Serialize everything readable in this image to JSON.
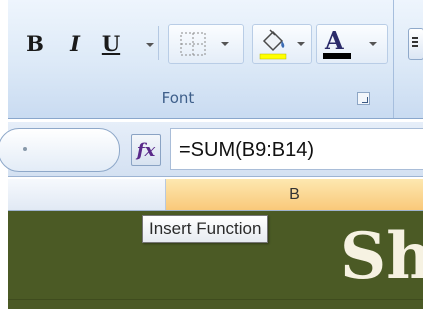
{
  "ribbon": {
    "font_group": {
      "label": "Font",
      "bold_label": "B",
      "italic_label": "I",
      "underline_label": "U",
      "font_color_label": "A",
      "font_color": "#000000",
      "fill_color": "#ffff00"
    }
  },
  "formula_bar": {
    "insert_function_label": "fx",
    "formula": "=SUM(B9:B14)"
  },
  "grid": {
    "column_b_label": "B",
    "sheet_background": "#4b5a25",
    "cell_text": "Sh"
  },
  "tooltip": {
    "text": "Insert Function"
  }
}
